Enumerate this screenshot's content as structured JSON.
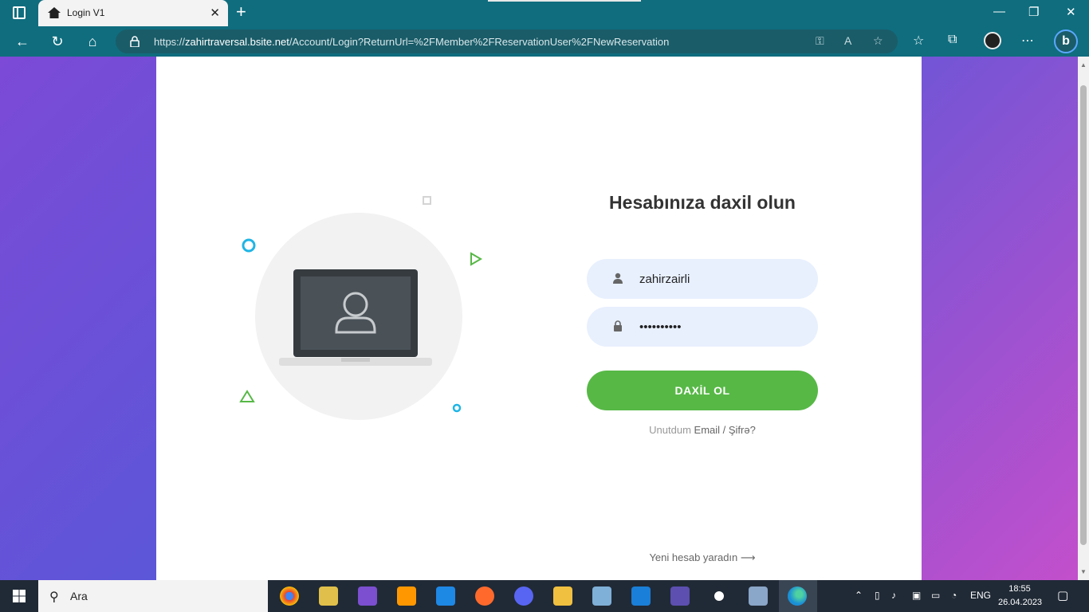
{
  "browser": {
    "tab_title": "Login V1",
    "url_prefix": "https://",
    "url_host": "zahirtraversal.bsite.net",
    "url_path": "/Account/Login?ReturnUrl=%2FMember%2FReservationUser%2FNewReservation"
  },
  "login": {
    "title": "Hesabınıza daxil olun",
    "username_value": "zahirzairli",
    "password_value": "••••••••••",
    "submit_label": "DAXİL OL",
    "forgot_prefix": "Unutdum",
    "forgot_link": "Email / Şifrə?",
    "create_account": "Yeni hesab yaradın",
    "accent_color": "#57b846"
  },
  "taskbar": {
    "search_placeholder": "Ara",
    "language": "ENG",
    "time": "18:55",
    "date": "26.04.2023"
  }
}
